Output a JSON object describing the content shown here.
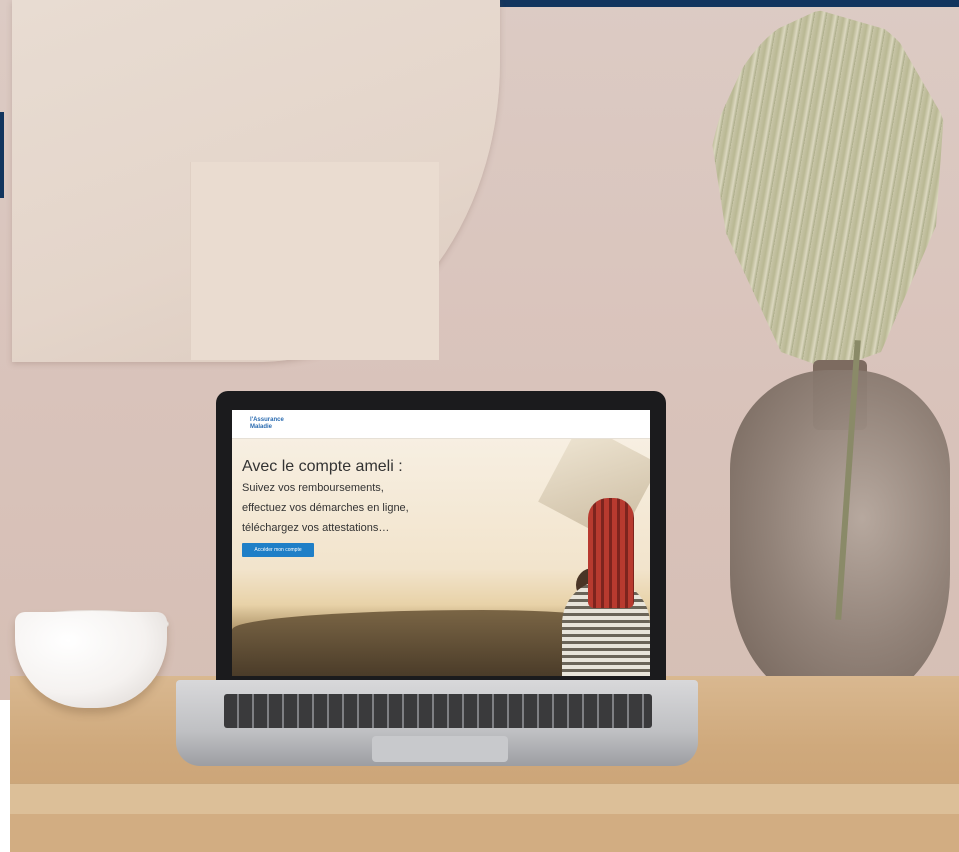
{
  "photo": {
    "screen": {
      "title": "Avec le compte ameli :",
      "lines": [
        "Suivez vos remboursements,",
        "effectuez vos démarches en ligne,",
        "téléchargez vos attestations…"
      ],
      "button_label": "Accéder mon compte",
      "logo_text": "l'Assurance Maladie"
    },
    "colors": {
      "wall": "#dccbc4",
      "frame_bar": "#12355e",
      "button": "#1f7fc7",
      "table": "#d2ad82"
    }
  }
}
